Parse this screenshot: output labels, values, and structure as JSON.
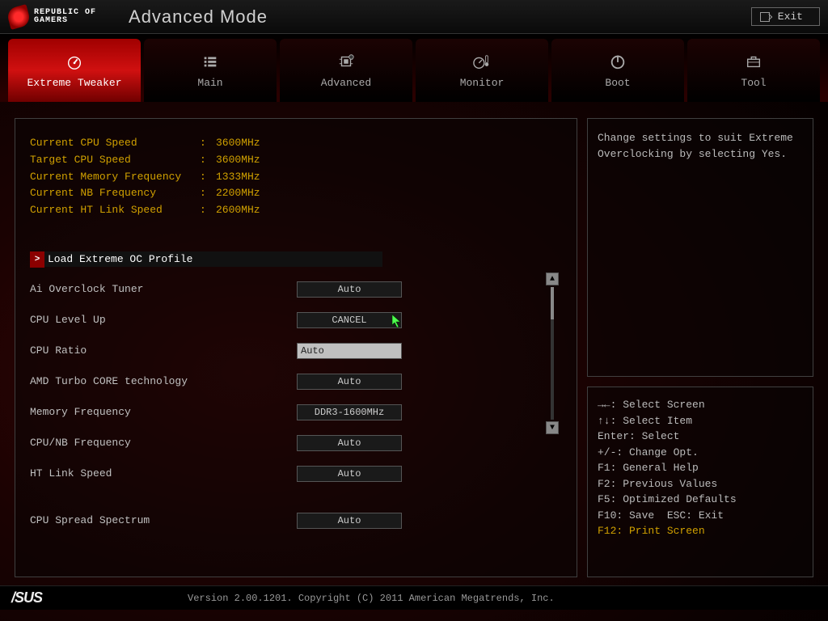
{
  "header": {
    "brand_line1": "REPUBLIC OF",
    "brand_line2": "GAMERS",
    "title": "Advanced Mode",
    "exit_label": "Exit"
  },
  "tabs": [
    {
      "label": "Extreme Tweaker",
      "icon": "gauge-icon",
      "active": true
    },
    {
      "label": "Main",
      "icon": "list-icon",
      "active": false
    },
    {
      "label": "Advanced",
      "icon": "chip-icon",
      "active": false
    },
    {
      "label": "Monitor",
      "icon": "thermometer-icon",
      "active": false
    },
    {
      "label": "Boot",
      "icon": "power-icon",
      "active": false
    },
    {
      "label": "Tool",
      "icon": "toolbox-icon",
      "active": false
    }
  ],
  "stats": [
    {
      "label": "Current CPU Speed",
      "value": "3600MHz"
    },
    {
      "label": "Target CPU Speed",
      "value": "3600MHz"
    },
    {
      "label": "Current Memory Frequency",
      "value": "1333MHz"
    },
    {
      "label": "Current NB Frequency",
      "value": "2200MHz"
    },
    {
      "label": "Current HT Link Speed",
      "value": "2600MHz"
    }
  ],
  "submenu": {
    "arrow": ">",
    "label": "Load Extreme OC Profile"
  },
  "settings": [
    {
      "label": "Ai Overclock Tuner",
      "value": "Auto",
      "style": "dark"
    },
    {
      "label": "CPU Level Up",
      "value": "CANCEL",
      "style": "dark"
    },
    {
      "label": "CPU Ratio",
      "value": "Auto",
      "style": "light"
    },
    {
      "label": "AMD Turbo CORE technology",
      "value": "Auto",
      "style": "dark"
    },
    {
      "label": "Memory Frequency",
      "value": "DDR3-1600MHz",
      "style": "dark"
    },
    {
      "label": "CPU/NB Frequency",
      "value": "Auto",
      "style": "dark"
    },
    {
      "label": "HT Link Speed",
      "value": "Auto",
      "style": "dark"
    },
    {
      "label": "CPU Spread Spectrum",
      "value": "Auto",
      "style": "dark",
      "gap": true
    }
  ],
  "help_text": "Change settings to suit Extreme Overclocking by selecting Yes.",
  "keys": [
    {
      "text": "→←: Select Screen"
    },
    {
      "text": "↑↓: Select Item"
    },
    {
      "text": "Enter: Select"
    },
    {
      "text": "+/-: Change Opt."
    },
    {
      "text": "F1: General Help"
    },
    {
      "text": "F2: Previous Values"
    },
    {
      "text": "F5: Optimized Defaults"
    },
    {
      "text": "F10: Save  ESC: Exit"
    },
    {
      "text": "F12: Print Screen",
      "highlight": true
    }
  ],
  "footer": {
    "logo": "/SUS",
    "copyright": "Version 2.00.1201. Copyright (C) 2011 American Megatrends, Inc."
  }
}
